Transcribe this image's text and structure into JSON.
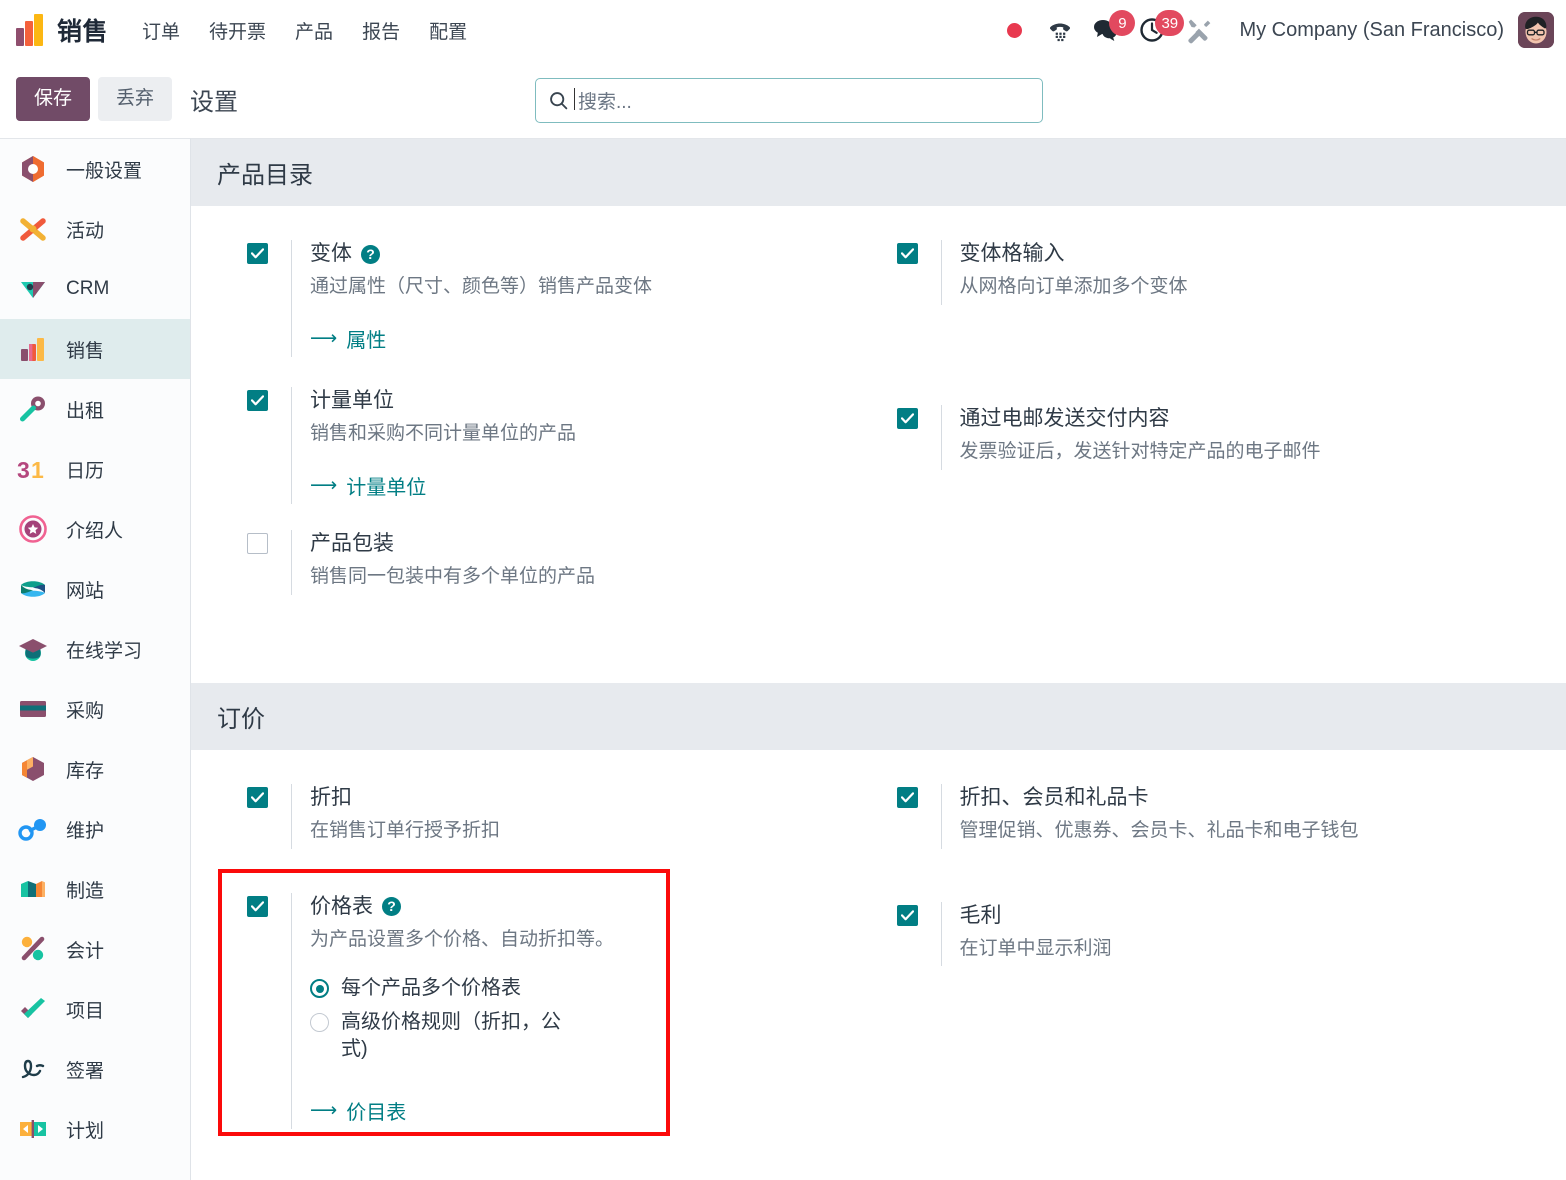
{
  "navbar": {
    "brand": "销售",
    "menu": [
      "订单",
      "待开票",
      "产品",
      "报告",
      "配置"
    ],
    "icons": {
      "presence": "red-dot-icon",
      "phone": "phone-dialpad-icon",
      "messages": "chat-bubble-icon",
      "activities": "clock-activity-icon",
      "developer": "tools-wrench-icon"
    },
    "messages_count": "9",
    "activities_count": "39",
    "company": "My Company (San Francisco)",
    "avatar": "user-avatar"
  },
  "control_panel": {
    "save_label": "保存",
    "discard_label": "丢弃",
    "title": "设置",
    "search_placeholder": "搜索..."
  },
  "sidebar": {
    "items": [
      {
        "label": "一般设置",
        "icon": "settings-gear-icon",
        "active": false
      },
      {
        "label": "活动",
        "icon": "discuss-activity-icon",
        "active": false
      },
      {
        "label": "CRM",
        "icon": "crm-icon",
        "active": false
      },
      {
        "label": "销售",
        "icon": "sales-bars-icon",
        "active": true
      },
      {
        "label": "出租",
        "icon": "rental-key-icon",
        "active": false
      },
      {
        "label": "日历",
        "icon": "calendar-31-icon",
        "active": false
      },
      {
        "label": "介绍人",
        "icon": "referral-badge-icon",
        "active": false
      },
      {
        "label": "网站",
        "icon": "website-icon",
        "active": false
      },
      {
        "label": "在线学习",
        "icon": "elearning-cap-icon",
        "active": false
      },
      {
        "label": "采购",
        "icon": "purchase-icon",
        "active": false
      },
      {
        "label": "库存",
        "icon": "inventory-box-icon",
        "active": false
      },
      {
        "label": "维护",
        "icon": "maintenance-icon",
        "active": false
      },
      {
        "label": "制造",
        "icon": "manufacturing-icon",
        "active": false
      },
      {
        "label": "会计",
        "icon": "accounting-icon",
        "active": false
      },
      {
        "label": "项目",
        "icon": "project-check-icon",
        "active": false
      },
      {
        "label": "签署",
        "icon": "sign-signature-icon",
        "active": false
      },
      {
        "label": "计划",
        "icon": "planning-icon",
        "active": false
      }
    ]
  },
  "sections": [
    {
      "title": "产品目录",
      "left": [
        {
          "title": "变体",
          "desc": "通过属性（尺寸、颜色等）销售产品变体",
          "checked": true,
          "has_help": true,
          "link": "属性"
        },
        {
          "title": "计量单位",
          "desc": "销售和采购不同计量单位的产品",
          "checked": true,
          "has_help": false,
          "link": "计量单位"
        },
        {
          "title": "产品包装",
          "desc": "销售同一包装中有多个单位的产品",
          "checked": false,
          "has_help": false,
          "link": null
        }
      ],
      "right": [
        {
          "title": "变体格输入",
          "desc": "从网格向订单添加多个变体",
          "checked": true,
          "has_help": false,
          "link": null
        },
        {
          "title": "通过电邮发送交付内容",
          "desc": "发票验证后，发送针对特定产品的电子邮件",
          "checked": true,
          "has_help": false,
          "link": null
        }
      ]
    },
    {
      "title": "订价",
      "left": [
        {
          "title": "折扣",
          "desc": "在销售订单行授予折扣",
          "checked": true,
          "has_help": false,
          "link": null
        },
        {
          "title": "价格表",
          "desc": "为产品设置多个价格、自动折扣等。",
          "checked": true,
          "has_help": true,
          "link": "价目表",
          "radios": [
            {
              "label": "每个产品多个价格表",
              "selected": true
            },
            {
              "label": "高级价格规则（折扣，公式)",
              "selected": false
            }
          ],
          "highlighted": true
        }
      ],
      "right": [
        {
          "title": "折扣、会员和礼品卡",
          "desc": "管理促销、优惠券、会员卡、礼品卡和电子钱包",
          "checked": true,
          "has_help": false,
          "link": null
        },
        {
          "title": "毛利",
          "desc": "在订单中显示利润",
          "checked": true,
          "has_help": false,
          "link": null
        }
      ]
    }
  ],
  "colors": {
    "accent_teal": "#017e84",
    "brand_purple": "#714b67",
    "badge_red": "#e2495f",
    "highlight_red": "#fb0a0a",
    "section_band": "#e7eaee",
    "sidebar_active": "#dfeced"
  }
}
